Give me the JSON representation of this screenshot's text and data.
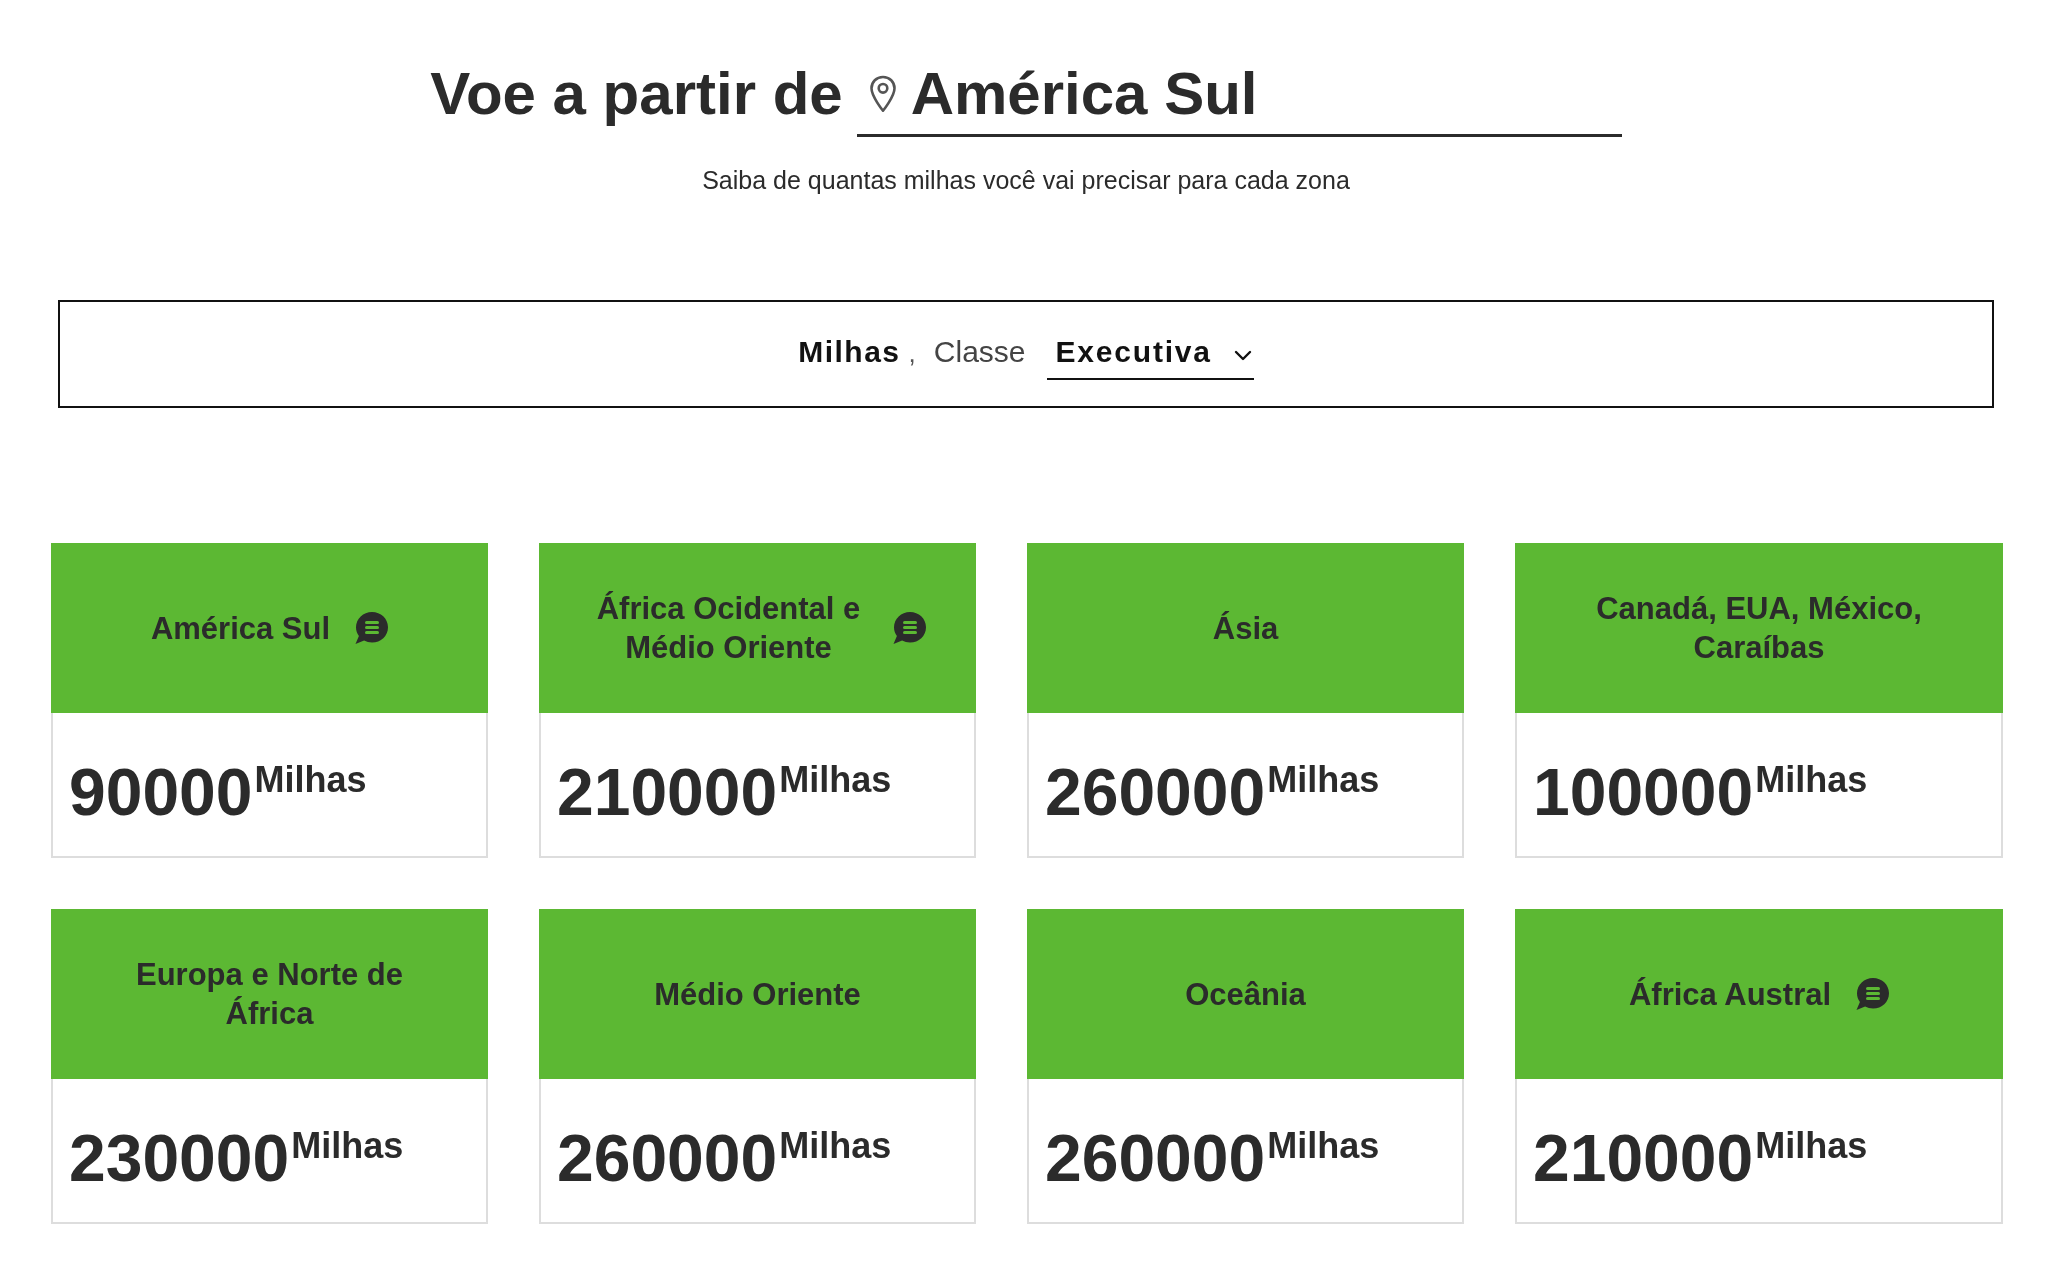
{
  "header": {
    "title": "Voe a partir de",
    "location_field": {
      "value": "América Sul"
    },
    "subtitle": "Saiba de quantas milhas você vai precisar para cada zona"
  },
  "filter_bar": {
    "unit": "Milhas",
    "separator": ",",
    "class_label": "Classe",
    "class_select": {
      "value": "Executiva"
    }
  },
  "zones": [
    {
      "name": "América Sul",
      "note": true,
      "miles": "90000",
      "unit": "Milhas"
    },
    {
      "name": "África Ocidental e Médio Oriente",
      "note": true,
      "miles": "210000",
      "unit": "Milhas"
    },
    {
      "name": "Ásia",
      "note": false,
      "miles": "260000",
      "unit": "Milhas"
    },
    {
      "name": "Canadá, EUA, México, Caraíbas",
      "note": false,
      "miles": "100000",
      "unit": "Milhas"
    },
    {
      "name": "Europa e Norte de África",
      "note": false,
      "miles": "230000",
      "unit": "Milhas"
    },
    {
      "name": "Médio Oriente",
      "note": false,
      "miles": "260000",
      "unit": "Milhas"
    },
    {
      "name": "Oceânia",
      "note": false,
      "miles": "260000",
      "unit": "Milhas"
    },
    {
      "name": "África Austral",
      "note": true,
      "miles": "210000",
      "unit": "Milhas"
    }
  ]
}
